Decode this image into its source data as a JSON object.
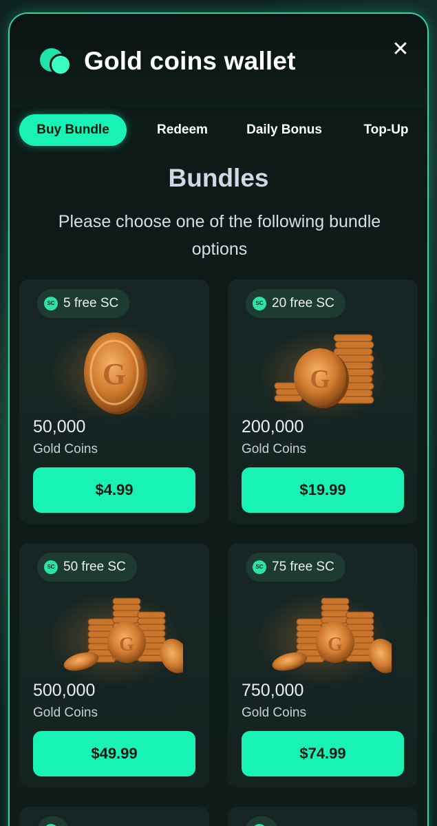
{
  "wallet": {
    "title": "Gold coins wallet",
    "close_label": "✕"
  },
  "tabs": [
    {
      "label": "Buy Bundle",
      "active": true
    },
    {
      "label": "Redeem",
      "active": false
    },
    {
      "label": "Daily Bonus",
      "active": false
    },
    {
      "label": "Top-Up",
      "active": false
    }
  ],
  "section": {
    "title": "Bundles",
    "description": "Please choose one of the following bundle options"
  },
  "bundles": [
    {
      "badge": "5 free SC",
      "amount": "50,000",
      "unit": "Gold Coins",
      "price": "$4.99",
      "art": "single-coin"
    },
    {
      "badge": "20 free SC",
      "amount": "200,000",
      "unit": "Gold Coins",
      "price": "$19.99",
      "art": "coin-stack"
    },
    {
      "badge": "50 free SC",
      "amount": "500,000",
      "unit": "Gold Coins",
      "price": "$49.99",
      "art": "coin-pile"
    },
    {
      "badge": "75 free SC",
      "amount": "750,000",
      "unit": "Gold Coins",
      "price": "$74.99",
      "art": "coin-pile"
    }
  ],
  "sc_icon_text": "SC",
  "colors": {
    "accent": "#19f2b5",
    "border": "#2fd7a2",
    "card": "#172624",
    "badge": "#1e3b33",
    "gold": "#d98a3c"
  }
}
